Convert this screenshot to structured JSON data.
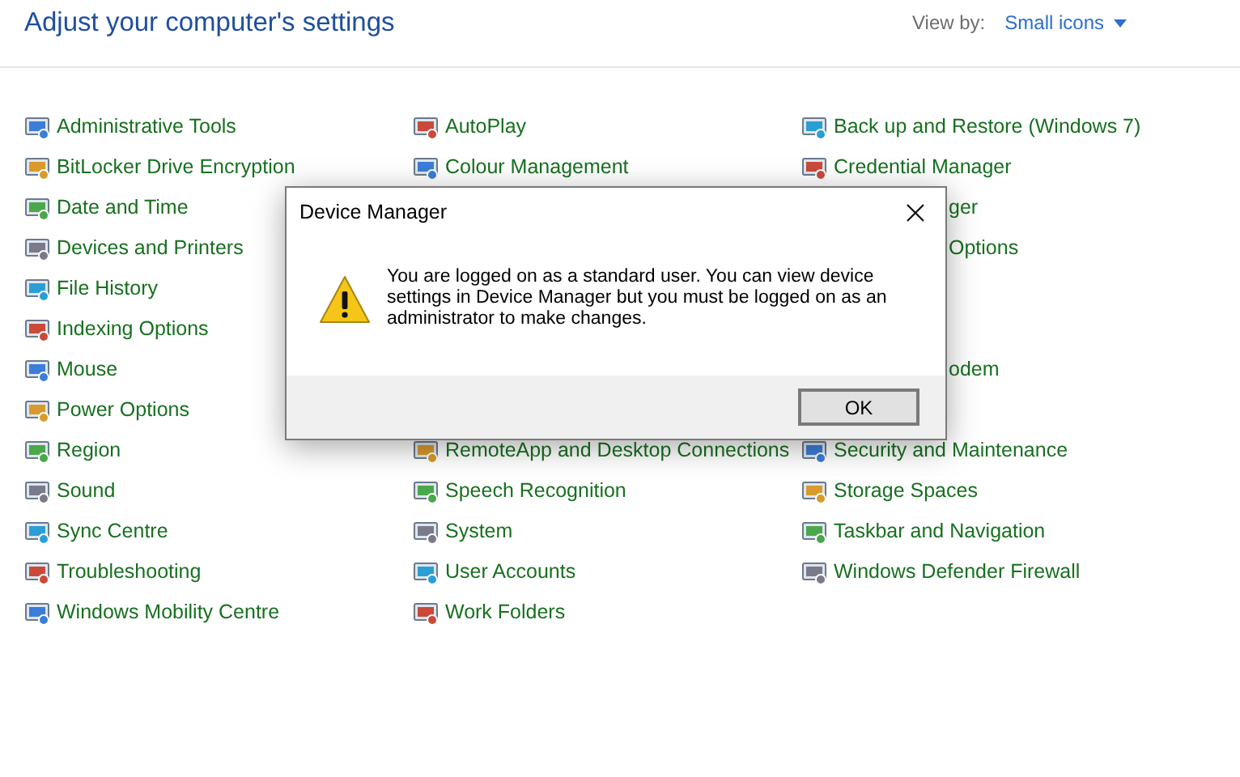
{
  "header": {
    "title": "Adjust your computer's settings",
    "view_by_label": "View by:",
    "view_by_value": "Small icons"
  },
  "columns": [
    {
      "items": [
        {
          "kind": "item",
          "label": "Administrative Tools"
        },
        {
          "kind": "item",
          "label": "BitLocker Drive Encryption"
        },
        {
          "kind": "item",
          "label": "Date and Time"
        },
        {
          "kind": "item",
          "label": "Devices and Printers"
        },
        {
          "kind": "item",
          "label": "File History"
        },
        {
          "kind": "item",
          "label": "Indexing Options"
        },
        {
          "kind": "item",
          "label": "Mouse"
        },
        {
          "kind": "item",
          "label": "Power Options"
        },
        {
          "kind": "item",
          "label": "Region"
        },
        {
          "kind": "item",
          "label": "Sound"
        },
        {
          "kind": "item",
          "label": "Sync Centre"
        },
        {
          "kind": "item",
          "label": "Troubleshooting"
        },
        {
          "kind": "item",
          "label": "Windows Mobility Centre"
        }
      ]
    },
    {
      "items": [
        {
          "kind": "item",
          "label": "AutoPlay"
        },
        {
          "kind": "item",
          "label": "Colour Management"
        },
        {
          "kind": "covered"
        },
        {
          "kind": "covered"
        },
        {
          "kind": "covered"
        },
        {
          "kind": "covered"
        },
        {
          "kind": "covered"
        },
        {
          "kind": "covered"
        },
        {
          "kind": "item",
          "label": "RemoteApp and Desktop Connections"
        },
        {
          "kind": "item",
          "label": "Speech Recognition"
        },
        {
          "kind": "item",
          "label": "System"
        },
        {
          "kind": "item",
          "label": "User Accounts"
        },
        {
          "kind": "item",
          "label": "Work Folders"
        }
      ]
    },
    {
      "items": [
        {
          "kind": "item",
          "label": "Back up and Restore (Windows 7)"
        },
        {
          "kind": "item",
          "label": "Credential Manager"
        },
        {
          "kind": "partial",
          "label": "ger"
        },
        {
          "kind": "partial",
          "label": "Options"
        },
        {
          "kind": "covered"
        },
        {
          "kind": "covered"
        },
        {
          "kind": "partial",
          "label": "odem"
        },
        {
          "kind": "covered"
        },
        {
          "kind": "item",
          "label": "Security and Maintenance"
        },
        {
          "kind": "item",
          "label": "Storage Spaces"
        },
        {
          "kind": "item",
          "label": "Taskbar and Navigation"
        },
        {
          "kind": "item",
          "label": "Windows Defender Firewall"
        }
      ]
    }
  ],
  "dialog": {
    "title": "Device Manager",
    "message": "You are logged on as a standard user. You can view device settings in Device Manager but you must be logged on as an administrator to make changes.",
    "button": "OK"
  }
}
